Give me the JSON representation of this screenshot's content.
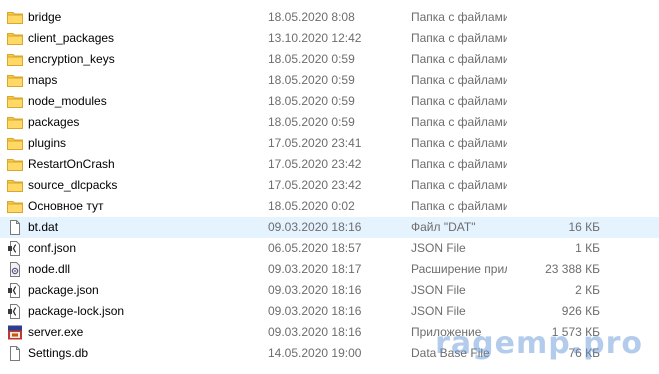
{
  "rows": [
    {
      "name": "bridge",
      "date": "18.05.2020 8:08",
      "type": "Папка с файлами",
      "size": "",
      "icon": "folder-icon"
    },
    {
      "name": "client_packages",
      "date": "13.10.2020 12:42",
      "type": "Папка с файлами",
      "size": "",
      "icon": "folder-icon"
    },
    {
      "name": "encryption_keys",
      "date": "18.05.2020 0:59",
      "type": "Папка с файлами",
      "size": "",
      "icon": "folder-icon"
    },
    {
      "name": "maps",
      "date": "18.05.2020 0:59",
      "type": "Папка с файлами",
      "size": "",
      "icon": "folder-icon"
    },
    {
      "name": "node_modules",
      "date": "18.05.2020 0:59",
      "type": "Папка с файлами",
      "size": "",
      "icon": "folder-icon"
    },
    {
      "name": "packages",
      "date": "18.05.2020 0:59",
      "type": "Папка с файлами",
      "size": "",
      "icon": "folder-icon"
    },
    {
      "name": "plugins",
      "date": "17.05.2020 23:41",
      "type": "Папка с файлами",
      "size": "",
      "icon": "folder-icon"
    },
    {
      "name": "RestartOnCrash",
      "date": "17.05.2020 23:42",
      "type": "Папка с файлами",
      "size": "",
      "icon": "folder-icon"
    },
    {
      "name": "source_dlcpacks",
      "date": "17.05.2020 23:42",
      "type": "Папка с файлами",
      "size": "",
      "icon": "folder-icon"
    },
    {
      "name": "Основное тут",
      "date": "18.05.2020 0:02",
      "type": "Папка с файлами",
      "size": "",
      "icon": "folder-icon"
    },
    {
      "name": "bt.dat",
      "date": "09.03.2020 18:16",
      "type": "Файл \"DAT\"",
      "size": "16 КБ",
      "icon": "file-icon"
    },
    {
      "name": "conf.json",
      "date": "06.05.2020 18:57",
      "type": "JSON File",
      "size": "1 КБ",
      "icon": "json-file-icon"
    },
    {
      "name": "node.dll",
      "date": "09.03.2020 18:17",
      "type": "Расширение приложения",
      "size": "23 388 КБ",
      "icon": "dll-file-icon"
    },
    {
      "name": "package.json",
      "date": "09.03.2020 18:16",
      "type": "JSON File",
      "size": "2 КБ",
      "icon": "json-file-icon"
    },
    {
      "name": "package-lock.json",
      "date": "09.03.2020 18:16",
      "type": "JSON File",
      "size": "926 КБ",
      "icon": "json-file-icon"
    },
    {
      "name": "server.exe",
      "date": "09.03.2020 18:16",
      "type": "Приложение",
      "size": "1 573 КБ",
      "icon": "exe-app-icon"
    },
    {
      "name": "Settings.db",
      "date": "14.05.2020 19:00",
      "type": "Data Base File",
      "size": "76 КБ",
      "icon": "db-file-icon"
    }
  ],
  "selected_row": "bt.dat",
  "watermark": "ragemp.pro",
  "colors": {
    "selection": "#e5f3ff",
    "folder": "#f5c542",
    "secondary_text": "#6d6d6d",
    "watermark": "#5b8fd6"
  }
}
